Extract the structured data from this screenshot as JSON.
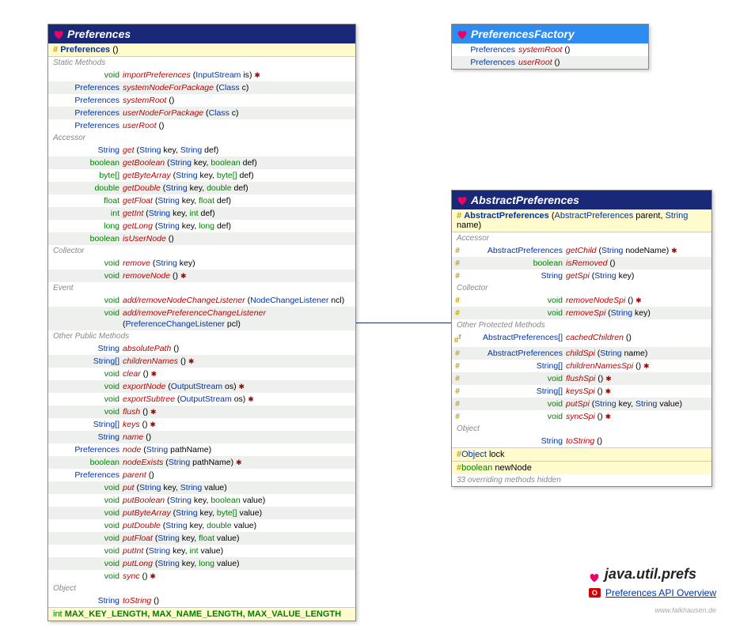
{
  "preferences": {
    "title": "Preferences",
    "constructor": {
      "vis": "#",
      "name": "Preferences",
      "params": "()"
    },
    "sections": [
      {
        "label": "Static Methods",
        "rows": [
          {
            "rt": "void",
            "rtc": "prim",
            "m": "importPreferences",
            "p": [
              [
                "InputStream",
                "is"
              ]
            ],
            "t": "✱"
          },
          {
            "rt": "Preferences",
            "rtc": "",
            "m": "systemNodeForPackage",
            "p": [
              [
                "Class<?>",
                "c"
              ]
            ]
          },
          {
            "rt": "Preferences",
            "rtc": "",
            "m": "systemRoot",
            "p": []
          },
          {
            "rt": "Preferences",
            "rtc": "",
            "m": "userNodeForPackage",
            "p": [
              [
                "Class<?>",
                "c"
              ]
            ]
          },
          {
            "rt": "Preferences",
            "rtc": "",
            "m": "userRoot",
            "p": []
          }
        ]
      },
      {
        "label": "Accessor",
        "rows": [
          {
            "rt": "String",
            "rtc": "",
            "m": "get",
            "p": [
              [
                "String",
                "key"
              ],
              [
                "String",
                "def"
              ]
            ]
          },
          {
            "rt": "boolean",
            "rtc": "prim",
            "m": "getBoolean",
            "p": [
              [
                "String",
                "key"
              ],
              [
                "boolean",
                "def",
                "prim"
              ]
            ]
          },
          {
            "rt": "byte[]",
            "rtc": "prim",
            "m": "getByteArray",
            "p": [
              [
                "String",
                "key"
              ],
              [
                "byte[]",
                "def",
                "prim"
              ]
            ]
          },
          {
            "rt": "double",
            "rtc": "prim",
            "m": "getDouble",
            "p": [
              [
                "String",
                "key"
              ],
              [
                "double",
                "def",
                "prim"
              ]
            ]
          },
          {
            "rt": "float",
            "rtc": "prim",
            "m": "getFloat",
            "p": [
              [
                "String",
                "key"
              ],
              [
                "float",
                "def",
                "prim"
              ]
            ]
          },
          {
            "rt": "int",
            "rtc": "prim",
            "m": "getInt",
            "p": [
              [
                "String",
                "key"
              ],
              [
                "int",
                "def",
                "prim"
              ]
            ]
          },
          {
            "rt": "long",
            "rtc": "prim",
            "m": "getLong",
            "p": [
              [
                "String",
                "key"
              ],
              [
                "long",
                "def",
                "prim"
              ]
            ]
          },
          {
            "rt": "boolean",
            "rtc": "prim",
            "m": "isUserNode",
            "p": []
          }
        ]
      },
      {
        "label": "Collector",
        "rows": [
          {
            "rt": "void",
            "rtc": "prim",
            "m": "remove",
            "p": [
              [
                "String",
                "key"
              ]
            ]
          },
          {
            "rt": "void",
            "rtc": "prim",
            "m": "removeNode",
            "p": [],
            "t": "✱"
          }
        ]
      },
      {
        "label": "Event",
        "rows": [
          {
            "rt": "void",
            "rtc": "prim",
            "m": "add/removeNodeChangeListener",
            "p": [
              [
                "NodeChangeListener",
                "ncl"
              ]
            ]
          },
          {
            "rt": "void",
            "rtc": "prim",
            "m": "add/removePreferenceChangeListener",
            "p": [
              [
                "PreferenceChangeListener",
                "pcl"
              ]
            ]
          }
        ]
      },
      {
        "label": "Other Public Methods",
        "rows": [
          {
            "rt": "String",
            "rtc": "",
            "m": "absolutePath",
            "p": []
          },
          {
            "rt": "String[]",
            "rtc": "",
            "m": "childrenNames",
            "p": [],
            "t": "✱"
          },
          {
            "rt": "void",
            "rtc": "prim",
            "m": "clear",
            "p": [],
            "t": "✱"
          },
          {
            "rt": "void",
            "rtc": "prim",
            "m": "exportNode",
            "p": [
              [
                "OutputStream",
                "os"
              ]
            ],
            "t": "✱"
          },
          {
            "rt": "void",
            "rtc": "prim",
            "m": "exportSubtree",
            "p": [
              [
                "OutputStream",
                "os"
              ]
            ],
            "t": "✱"
          },
          {
            "rt": "void",
            "rtc": "prim",
            "m": "flush",
            "p": [],
            "t": "✱"
          },
          {
            "rt": "String[]",
            "rtc": "",
            "m": "keys",
            "p": [],
            "t": "✱"
          },
          {
            "rt": "String",
            "rtc": "",
            "m": "name",
            "p": []
          },
          {
            "rt": "Preferences",
            "rtc": "",
            "m": "node",
            "p": [
              [
                "String",
                "pathName"
              ]
            ]
          },
          {
            "rt": "boolean",
            "rtc": "prim",
            "m": "nodeExists",
            "p": [
              [
                "String",
                "pathName"
              ]
            ],
            "t": "✱"
          },
          {
            "rt": "Preferences",
            "rtc": "",
            "m": "parent",
            "p": []
          },
          {
            "rt": "void",
            "rtc": "prim",
            "m": "put",
            "p": [
              [
                "String",
                "key"
              ],
              [
                "String",
                "value"
              ]
            ]
          },
          {
            "rt": "void",
            "rtc": "prim",
            "m": "putBoolean",
            "p": [
              [
                "String",
                "key"
              ],
              [
                "boolean",
                "value",
                "prim"
              ]
            ]
          },
          {
            "rt": "void",
            "rtc": "prim",
            "m": "putByteArray",
            "p": [
              [
                "String",
                "key"
              ],
              [
                "byte[]",
                "value",
                "prim"
              ]
            ]
          },
          {
            "rt": "void",
            "rtc": "prim",
            "m": "putDouble",
            "p": [
              [
                "String",
                "key"
              ],
              [
                "double",
                "value",
                "prim"
              ]
            ]
          },
          {
            "rt": "void",
            "rtc": "prim",
            "m": "putFloat",
            "p": [
              [
                "String",
                "key"
              ],
              [
                "float",
                "value",
                "prim"
              ]
            ]
          },
          {
            "rt": "void",
            "rtc": "prim",
            "m": "putInt",
            "p": [
              [
                "String",
                "key"
              ],
              [
                "int",
                "value",
                "prim"
              ]
            ]
          },
          {
            "rt": "void",
            "rtc": "prim",
            "m": "putLong",
            "p": [
              [
                "String",
                "key"
              ],
              [
                "long",
                "value",
                "prim"
              ]
            ]
          },
          {
            "rt": "void",
            "rtc": "prim",
            "m": "sync",
            "p": [],
            "t": "✱"
          }
        ]
      },
      {
        "label": "Object",
        "rows": [
          {
            "rt": "String",
            "rtc": "",
            "m": "toString",
            "p": []
          }
        ]
      }
    ],
    "constants": {
      "type": "int",
      "names": "MAX_KEY_LENGTH, MAX_NAME_LENGTH, MAX_VALUE_LENGTH"
    }
  },
  "factory": {
    "title": "PreferencesFactory",
    "rows": [
      {
        "rt": "Preferences",
        "m": "systemRoot",
        "p": []
      },
      {
        "rt": "Preferences",
        "m": "userRoot",
        "p": []
      }
    ]
  },
  "abstract": {
    "title": "AbstractPreferences",
    "constructor": {
      "vis": "#",
      "name": "AbstractPreferences",
      "params": [
        [
          "AbstractPreferences",
          "parent"
        ],
        [
          "String",
          "name"
        ]
      ]
    },
    "sections": [
      {
        "label": "Accessor",
        "rows": [
          {
            "vis": "#",
            "rt": "AbstractPreferences",
            "rtc": "",
            "m": "getChild",
            "p": [
              [
                "String",
                "nodeName"
              ]
            ],
            "t": "✱"
          },
          {
            "vis": "#",
            "rt": "boolean",
            "rtc": "prim",
            "m": "isRemoved",
            "p": []
          },
          {
            "vis": "#",
            "rt": "String",
            "rtc": "",
            "m": "getSpi",
            "p": [
              [
                "String",
                "key"
              ]
            ]
          }
        ]
      },
      {
        "label": "Collector",
        "rows": [
          {
            "vis": "#",
            "rt": "void",
            "rtc": "prim",
            "m": "removeNodeSpi",
            "p": [],
            "t": "✱"
          },
          {
            "vis": "#",
            "rt": "void",
            "rtc": "prim",
            "m": "removeSpi",
            "p": [
              [
                "String",
                "key"
              ]
            ]
          }
        ]
      },
      {
        "label": "Other Protected Methods",
        "rows": [
          {
            "vis": "#",
            "sup": "f",
            "rt": "AbstractPreferences[]",
            "rtc": "",
            "m": "cachedChildren",
            "p": []
          },
          {
            "vis": "#",
            "rt": "AbstractPreferences",
            "rtc": "",
            "m": "childSpi",
            "p": [
              [
                "String",
                "name"
              ]
            ]
          },
          {
            "vis": "#",
            "rt": "String[]",
            "rtc": "",
            "m": "childrenNamesSpi",
            "p": [],
            "t": "✱"
          },
          {
            "vis": "#",
            "rt": "void",
            "rtc": "prim",
            "m": "flushSpi",
            "p": [],
            "t": "✱"
          },
          {
            "vis": "#",
            "rt": "String[]",
            "rtc": "",
            "m": "keysSpi",
            "p": [],
            "t": "✱"
          },
          {
            "vis": "#",
            "rt": "void",
            "rtc": "prim",
            "m": "putSpi",
            "p": [
              [
                "String",
                "key"
              ],
              [
                "String",
                "value"
              ]
            ]
          },
          {
            "vis": "#",
            "rt": "void",
            "rtc": "prim",
            "m": "syncSpi",
            "p": [],
            "t": "✱"
          }
        ]
      },
      {
        "label": "Object",
        "rows": [
          {
            "rt": "String",
            "rtc": "",
            "m": "toString",
            "p": []
          }
        ]
      }
    ],
    "fields": [
      {
        "vis": "#",
        "type": "Object",
        "name": "lock"
      },
      {
        "vis": "#",
        "type": "boolean",
        "name": "newNode",
        "tc": "prim"
      }
    ],
    "footnote": "33 overriding methods hidden"
  },
  "footer": {
    "title": "java.util.prefs",
    "link": "Preferences API Overview",
    "vendor": "O"
  },
  "credit": "www.falkhausen.de"
}
